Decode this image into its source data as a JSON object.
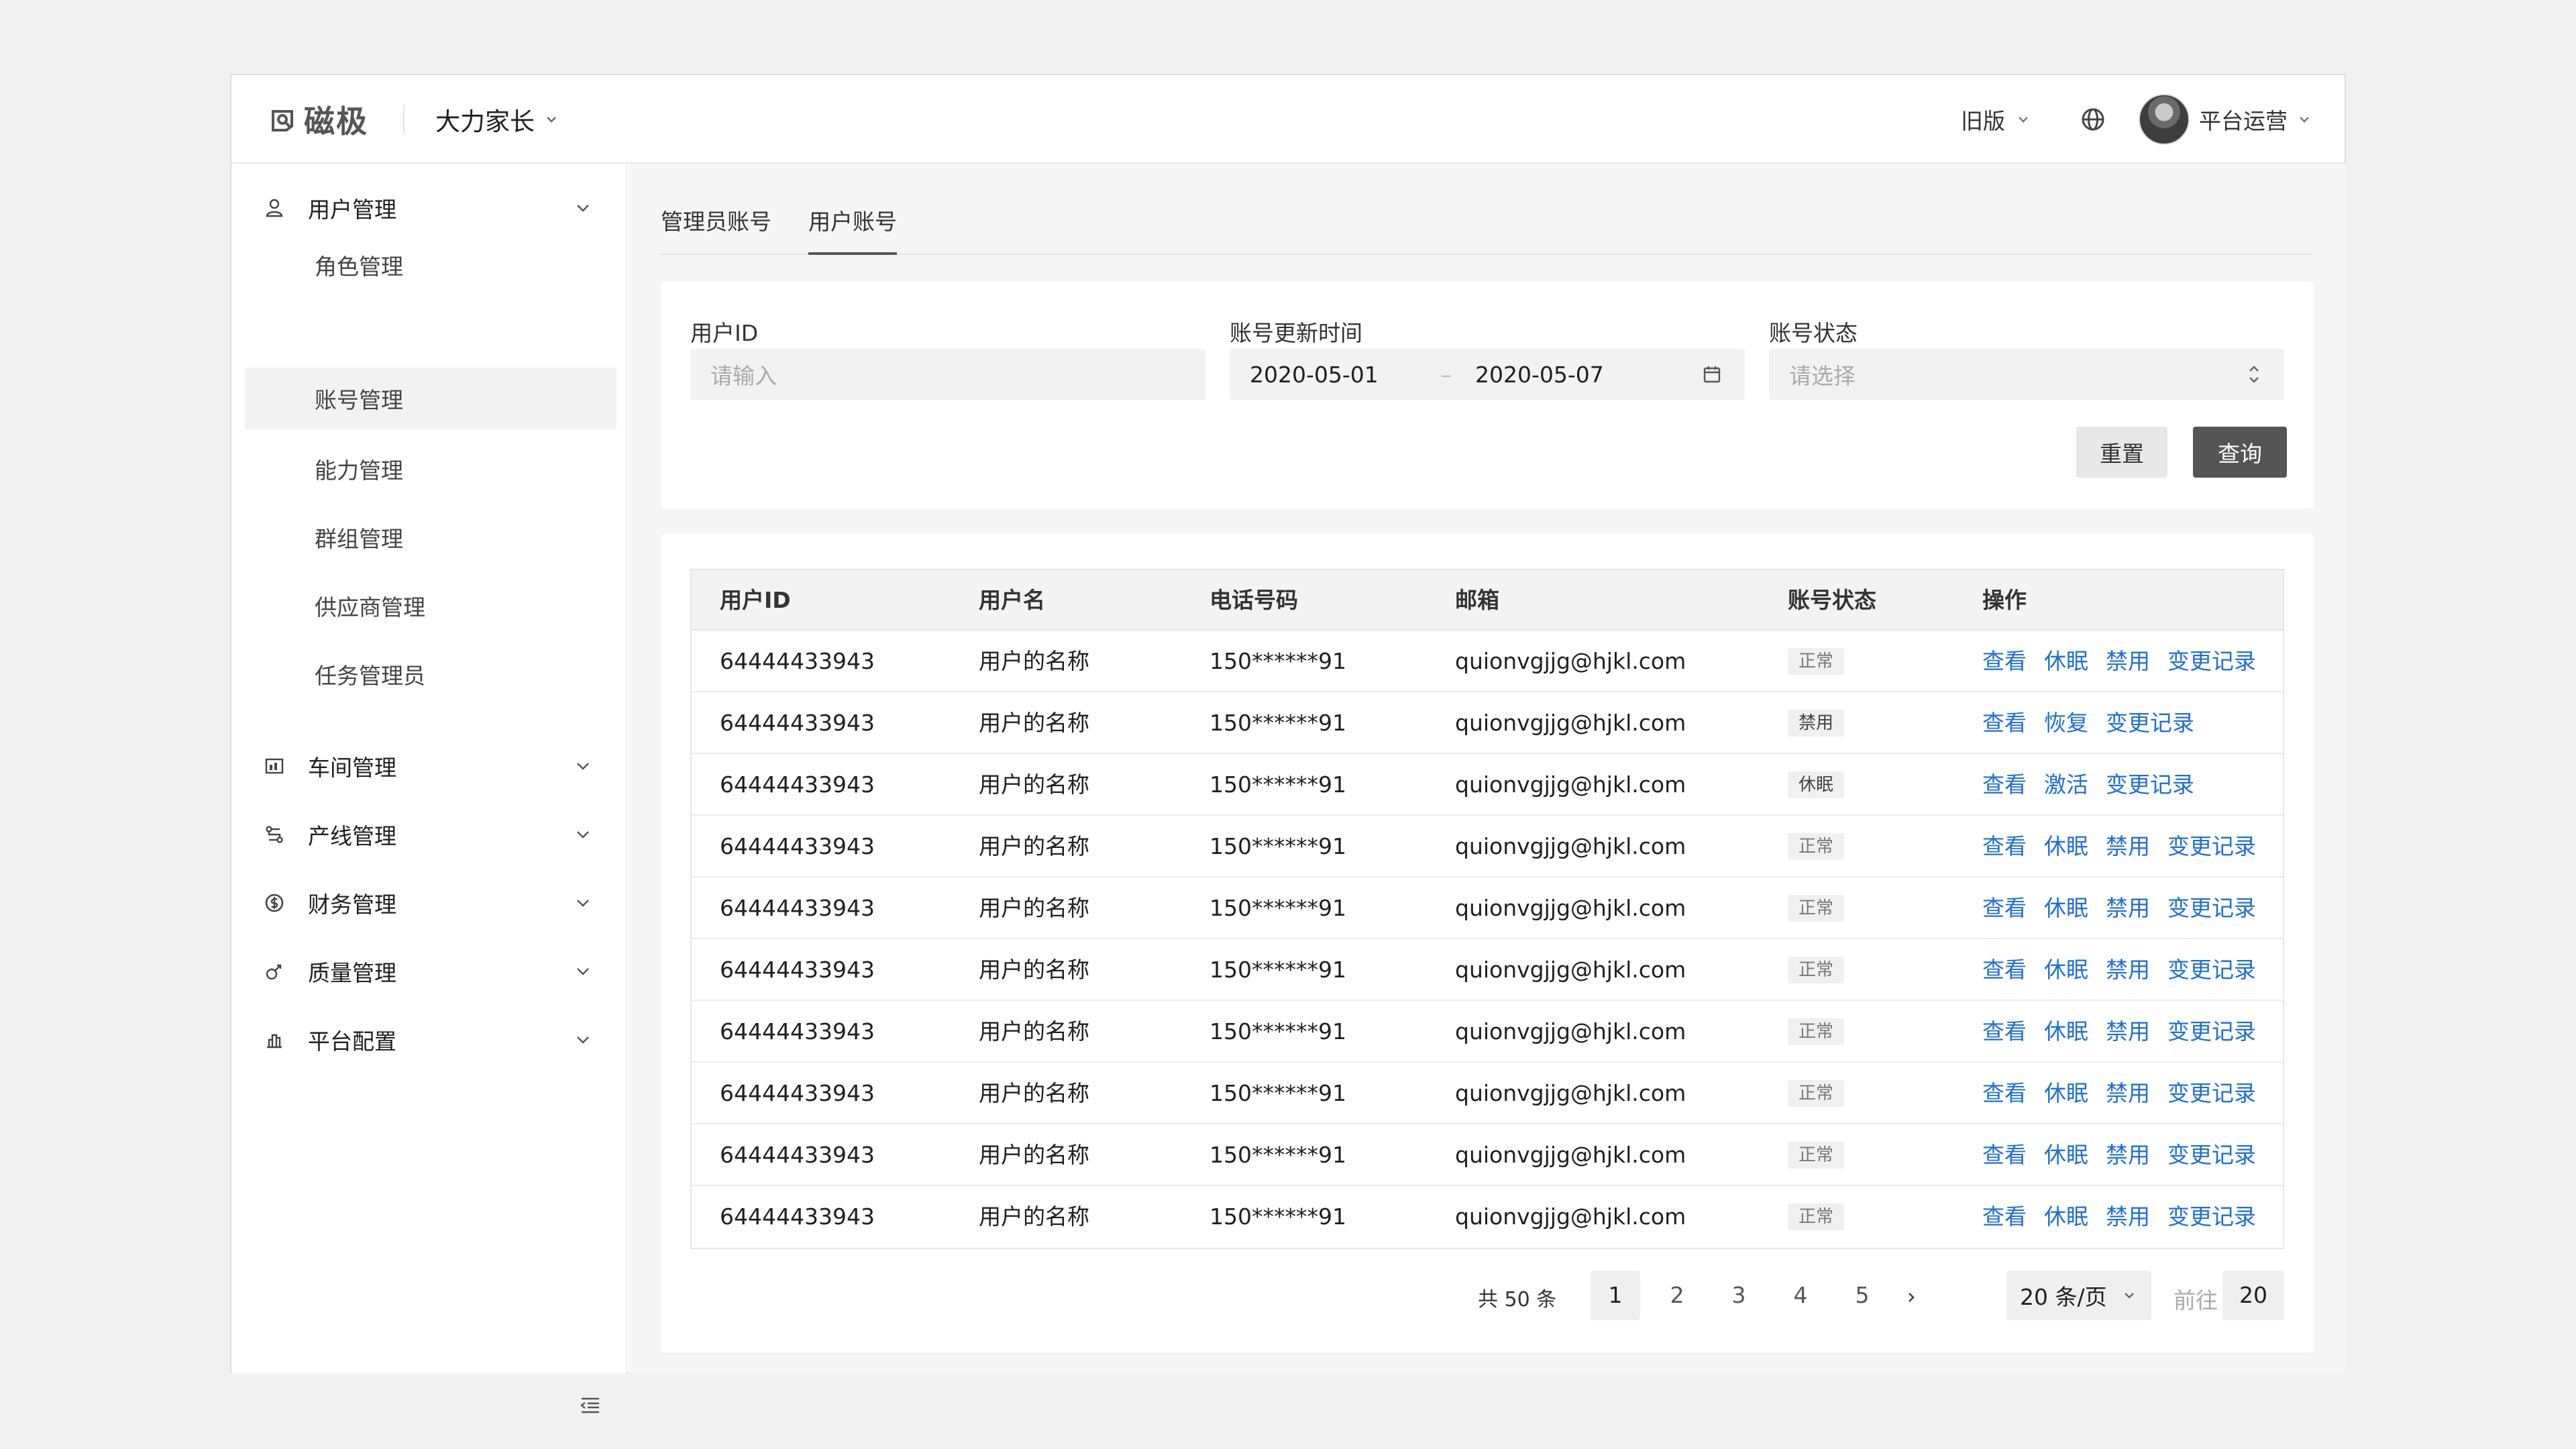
{
  "header": {
    "logo_text": "磁极",
    "workspace": "大力家长",
    "legacy_label": "旧版",
    "user_name": "平台运营"
  },
  "sidebar": {
    "groups": [
      {
        "label": "用户管理",
        "icon": "user-icon",
        "expanded": true
      },
      {
        "label": "车间管理",
        "icon": "workshop-icon",
        "expanded": false
      },
      {
        "label": "产线管理",
        "icon": "production-line-icon",
        "expanded": false
      },
      {
        "label": "财务管理",
        "icon": "finance-icon",
        "expanded": false
      },
      {
        "label": "质量管理",
        "icon": "quality-icon",
        "expanded": false
      },
      {
        "label": "平台配置",
        "icon": "platform-config-icon",
        "expanded": false
      }
    ],
    "subitems": [
      {
        "label": "角色管理",
        "active": false
      },
      {
        "label": "账号管理",
        "active": true
      },
      {
        "label": "能力管理",
        "active": false
      },
      {
        "label": "群组管理",
        "active": false
      },
      {
        "label": "供应商管理",
        "active": false
      },
      {
        "label": "任务管理员",
        "active": false
      }
    ]
  },
  "tabs": [
    {
      "label": "管理员账号",
      "active": false
    },
    {
      "label": "用户账号",
      "active": true
    }
  ],
  "filters": {
    "user_id_label": "用户ID",
    "user_id_placeholder": "请输入",
    "update_time_label": "账号更新时间",
    "date_start": "2020-05-01",
    "date_sep": "–",
    "date_end": "2020-05-07",
    "status_label": "账号状态",
    "status_placeholder": "请选择",
    "reset_label": "重置",
    "query_label": "查询"
  },
  "table": {
    "columns": [
      "用户ID",
      "用户名",
      "电话号码",
      "邮箱",
      "账号状态",
      "操作"
    ],
    "rows": [
      {
        "id": "64444433943",
        "name": "用户的名称",
        "phone": "150******91",
        "email": "quionvgjjg@hjkl.com",
        "status": "正常",
        "actions": [
          "查看",
          "休眠",
          "禁用",
          "变更记录"
        ]
      },
      {
        "id": "64444433943",
        "name": "用户的名称",
        "phone": "150******91",
        "email": "quionvgjjg@hjkl.com",
        "status": "禁用",
        "actions": [
          "查看",
          "恢复",
          "变更记录"
        ]
      },
      {
        "id": "64444433943",
        "name": "用户的名称",
        "phone": "150******91",
        "email": "quionvgjjg@hjkl.com",
        "status": "休眠",
        "actions": [
          "查看",
          "激活",
          "变更记录"
        ]
      },
      {
        "id": "64444433943",
        "name": "用户的名称",
        "phone": "150******91",
        "email": "quionvgjjg@hjkl.com",
        "status": "正常",
        "actions": [
          "查看",
          "休眠",
          "禁用",
          "变更记录"
        ]
      },
      {
        "id": "64444433943",
        "name": "用户的名称",
        "phone": "150******91",
        "email": "quionvgjjg@hjkl.com",
        "status": "正常",
        "actions": [
          "查看",
          "休眠",
          "禁用",
          "变更记录"
        ]
      },
      {
        "id": "64444433943",
        "name": "用户的名称",
        "phone": "150******91",
        "email": "quionvgjjg@hjkl.com",
        "status": "正常",
        "actions": [
          "查看",
          "休眠",
          "禁用",
          "变更记录"
        ]
      },
      {
        "id": "64444433943",
        "name": "用户的名称",
        "phone": "150******91",
        "email": "quionvgjjg@hjkl.com",
        "status": "正常",
        "actions": [
          "查看",
          "休眠",
          "禁用",
          "变更记录"
        ]
      },
      {
        "id": "64444433943",
        "name": "用户的名称",
        "phone": "150******91",
        "email": "quionvgjjg@hjkl.com",
        "status": "正常",
        "actions": [
          "查看",
          "休眠",
          "禁用",
          "变更记录"
        ]
      },
      {
        "id": "64444433943",
        "name": "用户的名称",
        "phone": "150******91",
        "email": "quionvgjjg@hjkl.com",
        "status": "正常",
        "actions": [
          "查看",
          "休眠",
          "禁用",
          "变更记录"
        ]
      },
      {
        "id": "64444433943",
        "name": "用户的名称",
        "phone": "150******91",
        "email": "quionvgjjg@hjkl.com",
        "status": "正常",
        "actions": [
          "查看",
          "休眠",
          "禁用",
          "变更记录"
        ]
      }
    ]
  },
  "pagination": {
    "total_text": "共 50 条",
    "pages": [
      "1",
      "2",
      "3",
      "4",
      "5"
    ],
    "current_page": "1",
    "page_size": "20 条/页",
    "goto_label": "前往",
    "goto_value": "20"
  },
  "colors": {
    "link": "#1f6fd6",
    "primary_button": "#555555",
    "active_nav_bg": "#f2f2f2"
  }
}
